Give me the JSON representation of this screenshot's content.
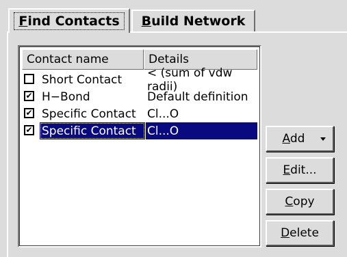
{
  "tabs": [
    {
      "label_first": "F",
      "label_rest": "ind Contacts",
      "active": true
    },
    {
      "label_first": "B",
      "label_rest": "uild Network",
      "active": false
    }
  ],
  "list": {
    "columns": [
      "Contact name",
      "Details"
    ],
    "rows": [
      {
        "name": "Short Contact",
        "details": "< (sum of vdw radii)",
        "checked": false,
        "check_glyph": ""
      },
      {
        "name": "H−Bond",
        "details": "Default definition",
        "checked": true,
        "check_glyph": "✔"
      },
      {
        "name": "Specific Contact",
        "details": "Cl...O",
        "checked": true,
        "check_glyph": "✔"
      },
      {
        "name": "Specific Contact",
        "details": "Cl...O",
        "checked": true,
        "check_glyph": "✔",
        "selected": true
      }
    ]
  },
  "buttons": {
    "add": {
      "first": "A",
      "rest": "dd"
    },
    "edit": {
      "first": "E",
      "rest": "dit..."
    },
    "copy": {
      "first": "C",
      "rest": "opy"
    },
    "delete": {
      "first": "D",
      "rest": "elete"
    }
  }
}
